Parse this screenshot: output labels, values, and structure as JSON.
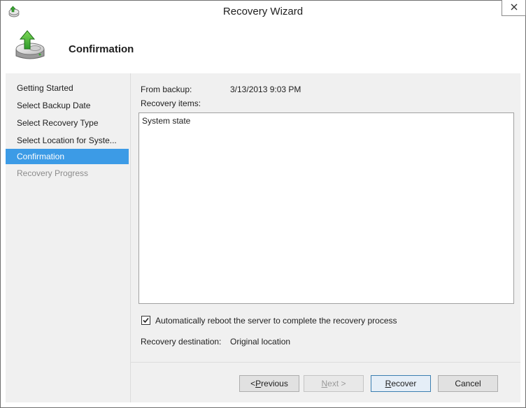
{
  "window": {
    "title": "Recovery Wizard"
  },
  "header": {
    "title": "Confirmation"
  },
  "nav": {
    "items": [
      {
        "label": "Getting Started",
        "state": "normal"
      },
      {
        "label": "Select Backup Date",
        "state": "normal"
      },
      {
        "label": "Select Recovery Type",
        "state": "normal"
      },
      {
        "label": "Select Location for Syste...",
        "state": "normal"
      },
      {
        "label": "Confirmation",
        "state": "active"
      },
      {
        "label": "Recovery Progress",
        "state": "disabled"
      }
    ]
  },
  "content": {
    "from_backup_label": "From backup:",
    "from_backup_value": "3/13/2013 9:03 PM",
    "recovery_items_label": "Recovery items:",
    "recovery_items": [
      "System state"
    ],
    "auto_reboot_label": "Automatically reboot the server to complete the recovery process",
    "auto_reboot_checked": true,
    "destination_label": "Recovery destination:",
    "destination_value": "Original location"
  },
  "buttons": {
    "previous_prefix": "< ",
    "previous_key": "P",
    "previous_rest": "revious",
    "next_key": "N",
    "next_rest": "ext >",
    "recover_key": "R",
    "recover_rest": "ecover",
    "cancel": "Cancel"
  },
  "colors": {
    "accent": "#3c9be6",
    "panel": "#f0f0f0"
  },
  "icons": {
    "title": "recovery-wizard-icon",
    "header": "backup-disk-arrow-icon",
    "close": "close-icon",
    "check": "checkmark-icon"
  }
}
